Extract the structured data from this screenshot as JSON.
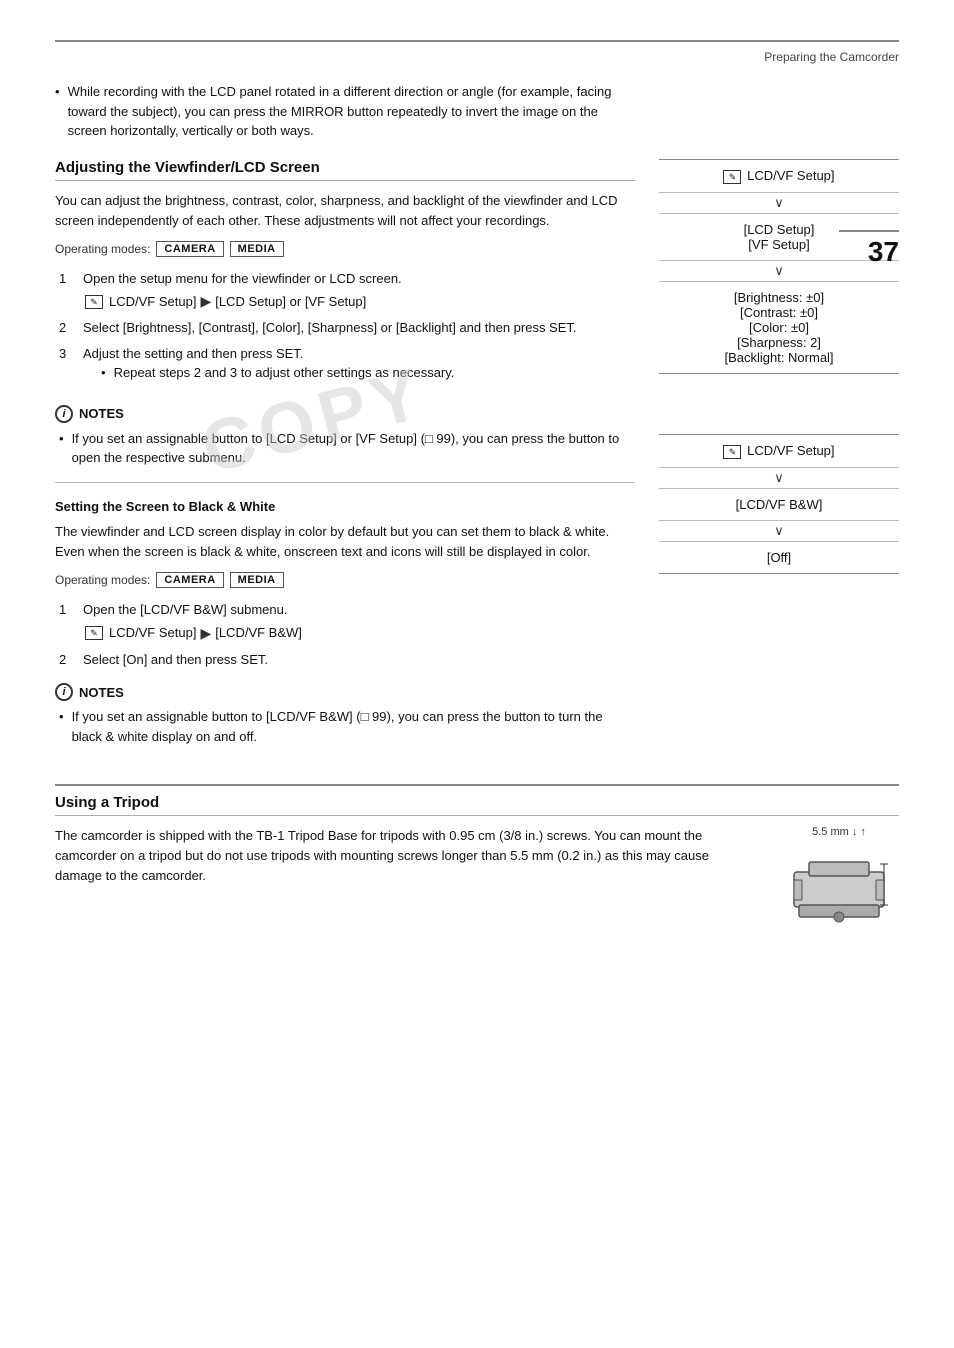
{
  "page": {
    "header": {
      "title": "Preparing the Camcorder",
      "page_number": "37"
    },
    "bullet_para": "While recording with the LCD panel rotated in a different direction or angle (for example, facing toward the subject), you can press the MIRROR button repeatedly to invert the image on the screen horizontally, vertically or both ways.",
    "section1": {
      "title": "Adjusting the Viewfinder/LCD Screen",
      "body": "You can adjust the brightness, contrast, color, sharpness, and backlight of the viewfinder and LCD screen independently of each other. These adjustments will not affect your recordings.",
      "operating_modes_label": "Operating modes:",
      "modes": [
        "CAMERA",
        "MEDIA"
      ],
      "steps": [
        {
          "num": "1",
          "text": "Open the setup menu for the viewfinder or LCD screen.",
          "menu_path": "[✎ LCD/VF Setup] ▶ [LCD Setup] or [VF Setup]"
        },
        {
          "num": "2",
          "text": "Select [Brightness], [Contrast], [Color], [Sharpness] or [Backlight] and then press SET."
        },
        {
          "num": "3",
          "text": "Adjust the setting and then press SET.",
          "sub_bullet": "Repeat steps 2 and 3 to adjust other settings as necessary."
        }
      ],
      "notes_label": "NOTES",
      "notes": [
        "If you set an assignable button to [LCD Setup] or [VF Setup] (□ 99), you can press the button to open the respective submenu."
      ],
      "sidebar": {
        "box1": "[✎ LCD/VF Setup]",
        "arrow1": "∨",
        "box2_line1": "[LCD Setup]",
        "box2_line2": "[VF Setup]",
        "arrow2": "∨",
        "box3_line1": "[Brightness: ±0]",
        "box3_line2": "[Contrast: ±0]",
        "box3_line3": "[Color: ±0]",
        "box3_line4": "[Sharpness: 2]",
        "box3_line5": "[Backlight: Normal]"
      }
    },
    "subsection1": {
      "title": "Setting the Screen to Black & White",
      "body": "The viewfinder and LCD screen display in color by default but you can set them to black & white. Even when the screen is black & white, onscreen text and icons will still be displayed in color.",
      "operating_modes_label": "Operating modes:",
      "modes": [
        "CAMERA",
        "MEDIA"
      ],
      "steps": [
        {
          "num": "1",
          "text": "Open the [LCD/VF B&W] submenu.",
          "menu_path": "[✎ LCD/VF Setup] ▶ [LCD/VF B&W]"
        },
        {
          "num": "2",
          "text": "Select [On] and then press SET."
        }
      ],
      "notes_label": "NOTES",
      "notes": [
        "If you set an assignable button to [LCD/VF B&W] (□ 99), you can press the button to turn the black & white display on and off."
      ],
      "sidebar": {
        "box1": "[✎ LCD/VF Setup]",
        "arrow1": "∨",
        "box2": "[LCD/VF B&W]",
        "arrow2": "∨",
        "box3": "[Off]"
      }
    },
    "section2": {
      "title": "Using a Tripod",
      "tripod_label": "5.5 mm",
      "body": "The camcorder is shipped with the TB-1 Tripod Base for tripods with 0.95 cm (3/8 in.) screws. You can mount the camcorder on a tripod but do not use tripods with mounting screws longer than 5.5 mm (0.2 in.) as this may cause damage to the camcorder."
    },
    "watermark": "COPY"
  }
}
